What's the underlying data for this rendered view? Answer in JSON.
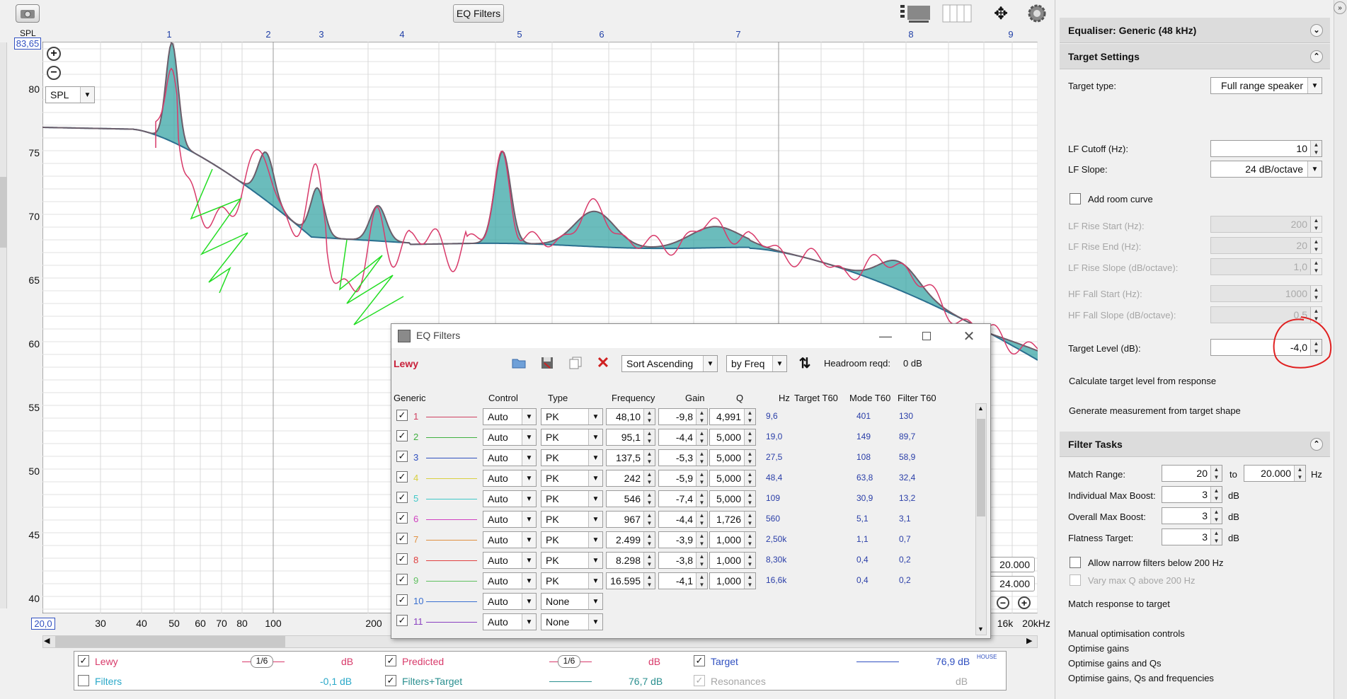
{
  "toolbar": {
    "eq_filters_button": "EQ Filters",
    "camera_icon": "camera-icon",
    "settings_icon": "gear-icon"
  },
  "graph": {
    "spl_label": "SPL",
    "spl_max": "83,65",
    "spl_select": "SPL",
    "y_ticks": [
      "80",
      "75",
      "70",
      "65",
      "60",
      "55",
      "50",
      "45",
      "40"
    ],
    "x_ticks": [
      "30",
      "40",
      "50",
      "60",
      "70",
      "80",
      "100",
      "200",
      "16k",
      "20kHz"
    ],
    "x_start": "20,0",
    "filter_numbers": [
      "1",
      "2",
      "3",
      "4",
      "5",
      "6",
      "7",
      "8",
      "9"
    ],
    "range_fields": [
      "20.000",
      "24.000"
    ],
    "zoom_in": "+",
    "zoom_out": "−"
  },
  "eq_window": {
    "title": "EQ Filters",
    "channel": "Lewy",
    "sort_select": "Sort Ascending",
    "by_select": "by Freq",
    "headroom_label": "Headroom reqd:",
    "headroom_value": "0 dB",
    "columns": [
      "Generic",
      "Control",
      "Type",
      "Frequency",
      "Gain",
      "Q",
      "Hz",
      "Target T60",
      "Mode T60",
      "Filter T60"
    ],
    "filters": [
      {
        "n": "1",
        "color": "#d04060",
        "control": "Auto",
        "type": "PK",
        "freq": "48,10",
        "gain": "-9,8",
        "q": "4,991",
        "hz": "9,6",
        "target": "",
        "mode": "401",
        "filt": "130"
      },
      {
        "n": "2",
        "color": "#40b040",
        "control": "Auto",
        "type": "PK",
        "freq": "95,1",
        "gain": "-4,4",
        "q": "5,000",
        "hz": "19,0",
        "target": "",
        "mode": "149",
        "filt": "89,7"
      },
      {
        "n": "3",
        "color": "#3050c0",
        "control": "Auto",
        "type": "PK",
        "freq": "137,5",
        "gain": "-5,3",
        "q": "5,000",
        "hz": "27,5",
        "target": "",
        "mode": "108",
        "filt": "58,9"
      },
      {
        "n": "4",
        "color": "#d8d040",
        "control": "Auto",
        "type": "PK",
        "freq": "242",
        "gain": "-5,9",
        "q": "5,000",
        "hz": "48,4",
        "target": "",
        "mode": "63,8",
        "filt": "32,4"
      },
      {
        "n": "5",
        "color": "#40c8c8",
        "control": "Auto",
        "type": "PK",
        "freq": "546",
        "gain": "-7,4",
        "q": "5,000",
        "hz": "109",
        "target": "",
        "mode": "30,9",
        "filt": "13,2"
      },
      {
        "n": "6",
        "color": "#d040c0",
        "control": "Auto",
        "type": "PK",
        "freq": "967",
        "gain": "-4,4",
        "q": "1,726",
        "hz": "560",
        "target": "",
        "mode": "5,1",
        "filt": "3,1"
      },
      {
        "n": "7",
        "color": "#e09040",
        "control": "Auto",
        "type": "PK",
        "freq": "2.499",
        "gain": "-3,9",
        "q": "1,000",
        "hz": "2,50k",
        "target": "",
        "mode": "1,1",
        "filt": "0,7"
      },
      {
        "n": "8",
        "color": "#e04040",
        "control": "Auto",
        "type": "PK",
        "freq": "8.298",
        "gain": "-3,8",
        "q": "1,000",
        "hz": "8,30k",
        "target": "",
        "mode": "0,4",
        "filt": "0,2"
      },
      {
        "n": "9",
        "color": "#60c060",
        "control": "Auto",
        "type": "PK",
        "freq": "16.595",
        "gain": "-4,1",
        "q": "1,000",
        "hz": "16,6k",
        "target": "",
        "mode": "0,4",
        "filt": "0,2"
      },
      {
        "n": "10",
        "color": "#3a70d0",
        "control": "Auto",
        "type": "None",
        "freq": "",
        "gain": "",
        "q": "",
        "hz": "",
        "target": "",
        "mode": "",
        "filt": ""
      },
      {
        "n": "11",
        "color": "#8a40c0",
        "control": "Auto",
        "type": "None",
        "freq": "",
        "gain": "",
        "q": "",
        "hz": "",
        "target": "",
        "mode": "",
        "filt": ""
      }
    ]
  },
  "legend": {
    "lewy": "Lewy",
    "lewy_smooth": "1/6",
    "lewy_val": "dB",
    "predicted": "Predicted",
    "pred_smooth": "1/6",
    "pred_val": "dB",
    "target": "Target",
    "target_val": "76,9 dB",
    "target_sup": "HOUSE",
    "filters": "Filters",
    "filters_val": "-0,1 dB",
    "filters_target": "Filters+Target",
    "ft_val": "76,7 dB",
    "resonances": "Resonances",
    "res_val": "dB"
  },
  "right_panel": {
    "equaliser": "Equaliser: Generic (48 kHz)",
    "target_settings": "Target Settings",
    "target_type_label": "Target type:",
    "target_type": "Full range speaker",
    "lf_cutoff_label": "LF Cutoff (Hz):",
    "lf_cutoff": "10",
    "lf_slope_label": "LF Slope:",
    "lf_slope": "24 dB/octave",
    "add_room_curve": "Add room curve",
    "lf_rise_start_label": "LF Rise Start (Hz):",
    "lf_rise_start": "200",
    "lf_rise_end_label": "LF Rise End (Hz):",
    "lf_rise_end": "20",
    "lf_rise_slope_label": "LF Rise Slope (dB/octave):",
    "lf_rise_slope": "1,0",
    "hf_fall_start_label": "HF Fall Start (Hz):",
    "hf_fall_start": "1000",
    "hf_fall_slope_label": "HF Fall Slope (dB/octave):",
    "hf_fall_slope": "0,5",
    "target_level_label": "Target Level (dB):",
    "target_level": "-4,0",
    "calc_target": "Calculate target level from response",
    "gen_measurement": "Generate measurement from target shape",
    "filter_tasks": "Filter Tasks",
    "match_range_label": "Match Range:",
    "match_from": "20",
    "match_to_label": "to",
    "match_to": "20.000",
    "match_unit": "Hz",
    "indiv_boost_label": "Individual Max Boost:",
    "indiv_boost": "3",
    "db1": "dB",
    "overall_boost_label": "Overall Max Boost:",
    "overall_boost": "3",
    "db2": "dB",
    "flatness_label": "Flatness Target:",
    "flatness": "3",
    "db3": "dB",
    "allow_narrow": "Allow narrow filters below 200 Hz",
    "vary_q": "Vary max Q above 200 Hz",
    "match_response": "Match response to target",
    "manual_opt": "Manual optimisation controls",
    "opt_gains": "Optimise gains",
    "opt_gains_qs": "Optimise gains and Qs",
    "opt_all": "Optimise gains, Qs and frequencies"
  }
}
